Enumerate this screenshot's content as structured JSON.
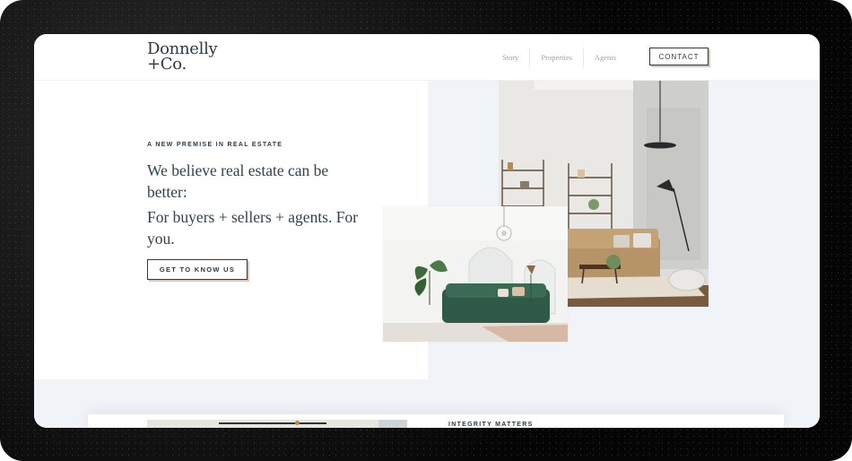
{
  "brand": {
    "line1": "Donnelly",
    "line2": "+Co."
  },
  "nav": {
    "items": [
      "Story",
      "Properties",
      "Agents"
    ],
    "contact_label": "CONTACT"
  },
  "hero": {
    "eyebrow": "A NEW PREMISE IN REAL ESTATE",
    "headline": "We believe real estate can be better:",
    "subheadline": "For buyers + sellers + agents. For you.",
    "cta_label": "GET TO KNOW US"
  },
  "next_section": {
    "eyebrow": "INTEGRITY MATTERS"
  },
  "colors": {
    "ink": "#2b3a46",
    "accent_shadow": "#d9c6b8",
    "panel": "#f0f4f8"
  }
}
